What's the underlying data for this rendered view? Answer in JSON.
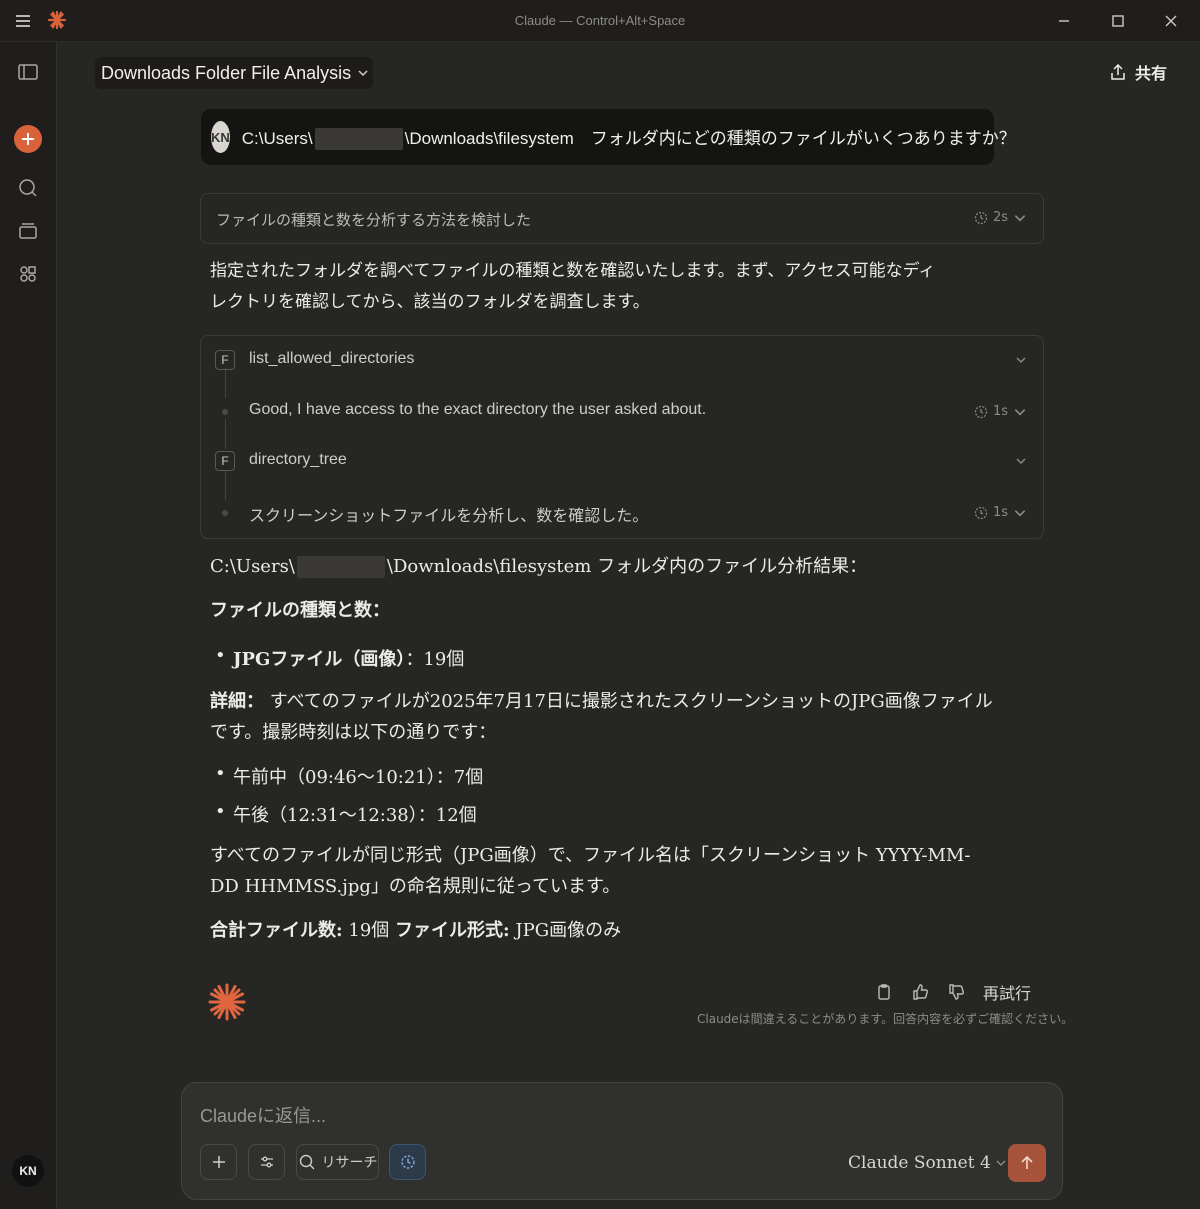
{
  "window": {
    "title": "Claude — Control+Alt+Space"
  },
  "header": {
    "conversation_title": "Downloads Folder File Analysis",
    "share_label": "共有"
  },
  "sidebar": {
    "user_initials": "KN"
  },
  "user_message": {
    "initials": "KN",
    "text_before": "C:\\Users\\",
    "text_after": "\\Downloads\\filesystem　フォルダ内にどの種類のファイルがいくつありますか？"
  },
  "thinking": {
    "label": "ファイルの種類と数を分析する方法を検討した",
    "duration": "2s"
  },
  "intro": {
    "line1": "指定されたフォルダを調べてファイルの種類と数を確認いたします。まず、アクセス可能なディ",
    "line2": "レクトリを確認してから、該当のフォルダを調査します。"
  },
  "tool_steps": [
    {
      "badge": "F",
      "name": "list_allowed_directories"
    },
    {
      "note": "Good, I have access to the exact directory the user asked about.",
      "duration": "1s"
    },
    {
      "badge": "F",
      "name": "directory_tree"
    },
    {
      "note": "スクリーンショットファイルを分析し、数を確認した。",
      "duration": "1s"
    }
  ],
  "response": {
    "path_before": "C:\\Users\\",
    "path_after": "\\Downloads\\filesystem フォルダ内のファイル分析結果：",
    "types_heading": "ファイルの種類と数：",
    "jpg_bullet_bold": "JPGファイル（画像）",
    "jpg_bullet_rest": "：19個",
    "details_bold": "詳細：",
    "details_line1": "すべてのファイルが2025年7月17日に撮影されたスクリーンショットのJPG画像ファイル",
    "details_line2": "です。撮影時刻は以下の通りです：",
    "morning": "午前中（09:46〜10:21）：7個",
    "afternoon": "午後（12:31〜12:38）：12個",
    "naming_line1": "すべてのファイルが同じ形式（JPG画像）で、ファイル名は「スクリーンショット YYYY-MM-",
    "naming_line2": "DD HHMMSS.jpg」の命名規則に従っています。",
    "total_bold": "合計ファイル数:",
    "total_value": " 19個 ",
    "format_bold": "ファイル形式:",
    "format_value": " JPG画像のみ"
  },
  "actions": {
    "retry_label": "再試行",
    "disclaimer": "Claudeは間違えることがあります。回答内容を必ずご確認ください。"
  },
  "composer": {
    "placeholder": "Claudeに返信...",
    "research_label": "リサーチ",
    "model": "Claude Sonnet 4"
  },
  "colors": {
    "accent": "#d9623b",
    "send_button": "#a7533a",
    "background": "#262624"
  }
}
